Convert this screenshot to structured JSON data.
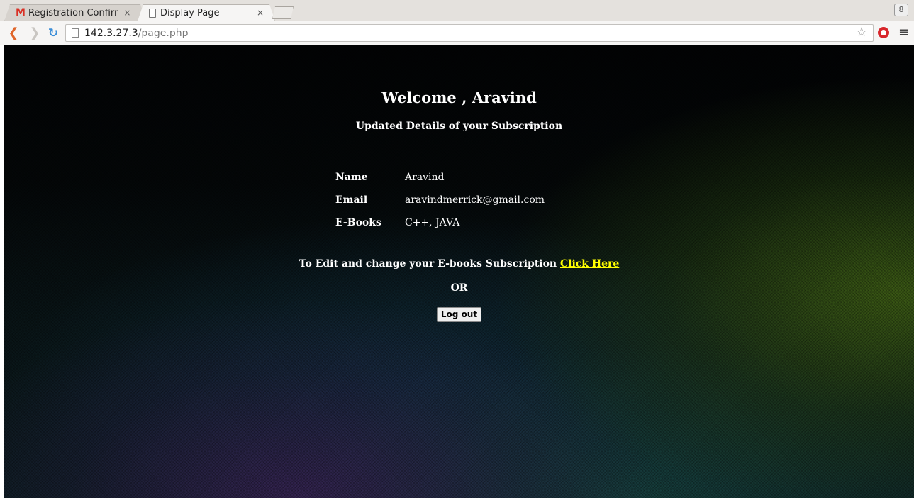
{
  "browser": {
    "tabs": [
      {
        "title": "Registration Confirr",
        "icon": "gmail-icon",
        "active": false
      },
      {
        "title": "Display Page",
        "icon": "page-icon",
        "active": true
      }
    ],
    "url_host": "142.3.27.3",
    "url_path": "/page.php",
    "close_glyph": "×",
    "profile_glyph": "8"
  },
  "page": {
    "welcome": "Welcome , Aravind",
    "subtitle": "Updated Details of your Subscription",
    "details": [
      {
        "label": "Name",
        "value": "Aravind"
      },
      {
        "label": "Email",
        "value": "aravindmerrick@gmail.com"
      },
      {
        "label": "E-Books",
        "value": "C++, JAVA"
      }
    ],
    "edit_text": "To Edit and change your E-books Subscription ",
    "edit_link": "Click Here",
    "or_text": "OR",
    "logout_label": "Log out",
    "link_color": "#ffff00"
  }
}
